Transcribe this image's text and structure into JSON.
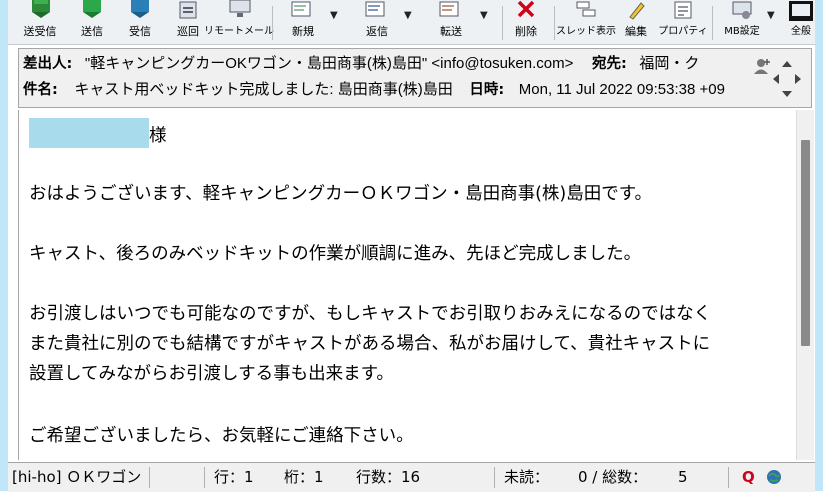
{
  "toolbar": {
    "buttons": [
      {
        "label": "送受信"
      },
      {
        "label": "送信"
      },
      {
        "label": "受信"
      },
      {
        "label": "巡回"
      },
      {
        "label": "リモートメール"
      },
      {
        "label": "新規"
      },
      {
        "label": "返信"
      },
      {
        "label": "転送"
      },
      {
        "label": "削除"
      },
      {
        "label": "スレッド表示"
      },
      {
        "label": "編集"
      },
      {
        "label": "プロパティ"
      },
      {
        "label": "MB設定"
      },
      {
        "label": "全般"
      }
    ]
  },
  "header": {
    "from_label": "差出人:",
    "from_value": "\"軽キャンピングカーOKワゴン・島田商事(株)島田\" <info@tosuken.com>",
    "to_label": "宛先:",
    "to_value": "福岡・ク",
    "subject_label": "件名:",
    "subject_value": "キャスト用ベッドキット完成しました: 島田商事(株)島田",
    "date_label": "日時:",
    "date_value": "Mon, 11 Jul 2022 09:53:38 +09"
  },
  "body": {
    "salutation_suffix": "様",
    "lines": [
      "おはようございます、軽キャンピングカーＯＫワゴン・島田商事(株)島田です。",
      "キャスト、後ろのみベッドキットの作業が順調に進み、先ほど完成しました。",
      "お引渡しはいつでも可能なのですが、もしキャストでお引取りおみえになるのではなく",
      "また貴社に別のでも結構ですがキャストがある場合、私がお届けして、貴社キャストに",
      "設置してみながらお引渡しする事も出来ます。",
      "ご希望ございましたら、お気軽にご連絡下さい。"
    ]
  },
  "status": {
    "account": "[hi-ho] ＯＫワゴン",
    "line": "行：1",
    "column": "桁：1",
    "line_count": "行数：16",
    "unread_label": "未読：",
    "unread_value": "0 / 総数：",
    "total_value": "5",
    "q_label": "Q"
  },
  "colors": {
    "accent_red": "#d0021b",
    "redaction": "#a8dcec",
    "frame": "#bfe7f7"
  }
}
